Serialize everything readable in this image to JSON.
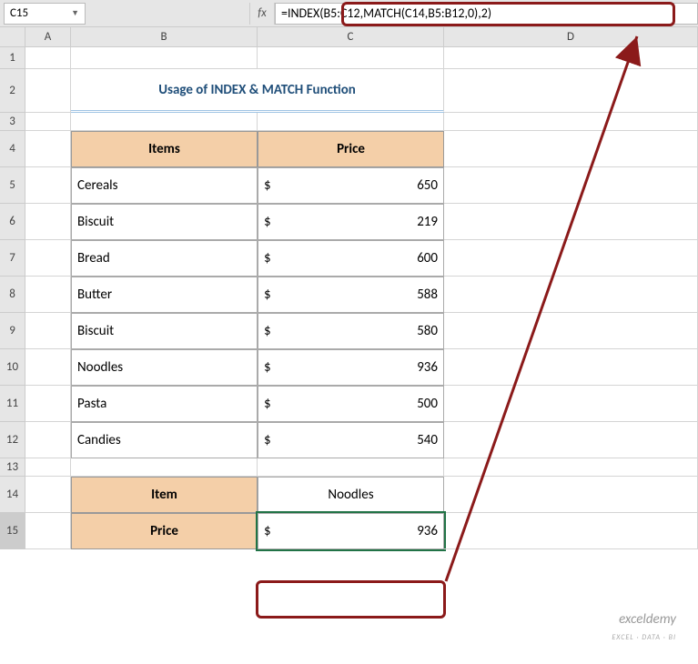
{
  "nameBox": "C15",
  "fxLabel": "fx",
  "formula": "=INDEX(B5:C12,MATCH(C14,B5:B12,0),2)",
  "colHeaders": [
    "A",
    "B",
    "C",
    "D"
  ],
  "rowHeaders": [
    "1",
    "2",
    "3",
    "4",
    "5",
    "6",
    "7",
    "8",
    "9",
    "10",
    "11",
    "12",
    "13",
    "14",
    "15"
  ],
  "title": "Usage of INDEX & MATCH Function",
  "headers": {
    "items": "Items",
    "price": "Price",
    "item": "Item",
    "priceLabel": "Price"
  },
  "currency": "$",
  "rows": [
    {
      "item": "Cereals",
      "price": "650"
    },
    {
      "item": "Biscuit",
      "price": "219"
    },
    {
      "item": "Bread",
      "price": "600"
    },
    {
      "item": "Butter",
      "price": "588"
    },
    {
      "item": "Biscuit",
      "price": "580"
    },
    {
      "item": "Noodles",
      "price": "936"
    },
    {
      "item": "Pasta",
      "price": "500"
    },
    {
      "item": "Candies",
      "price": "540"
    }
  ],
  "lookup": {
    "item": "Noodles",
    "price": "936"
  },
  "watermark": {
    "main": "exceldemy",
    "sub": "EXCEL · DATA · BI"
  },
  "chart_data": {
    "type": "table",
    "columns": [
      "Items",
      "Price"
    ],
    "data": [
      [
        "Cereals",
        650
      ],
      [
        "Biscuit",
        219
      ],
      [
        "Bread",
        600
      ],
      [
        "Butter",
        588
      ],
      [
        "Biscuit",
        580
      ],
      [
        "Noodles",
        936
      ],
      [
        "Pasta",
        500
      ],
      [
        "Candies",
        540
      ]
    ],
    "lookup": {
      "Item": "Noodles",
      "Price": 936
    },
    "formula": "=INDEX(B5:C12,MATCH(C14,B5:B12,0),2)"
  }
}
